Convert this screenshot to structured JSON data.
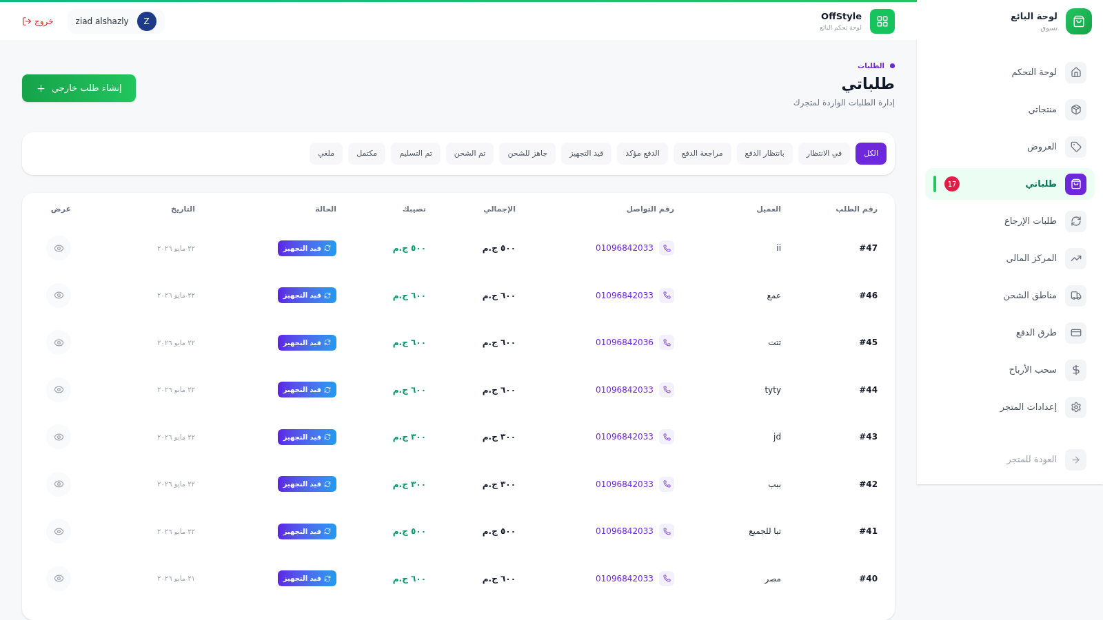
{
  "sidebar": {
    "title": "لوحة البائع",
    "subtitle": "تسوق",
    "items": [
      {
        "label": "لوحة التحكم",
        "selected": false
      },
      {
        "label": "منتجاتي",
        "selected": false
      },
      {
        "label": "العروض",
        "selected": false
      },
      {
        "label": "طلباتي",
        "selected": true,
        "badge": "17"
      },
      {
        "label": "طلبات الإرجاع",
        "selected": false
      },
      {
        "label": "المركز المالي",
        "selected": false
      },
      {
        "label": "مناطق الشحن",
        "selected": false
      },
      {
        "label": "طرق الدفع",
        "selected": false
      },
      {
        "label": "سحب الأرباح",
        "selected": false
      },
      {
        "label": "إعدادات المتجر",
        "selected": false
      }
    ],
    "back_link": "العودة للمتجر"
  },
  "header": {
    "brand": "OffStyle",
    "brand_subtitle": "لوحة تحكم البائع",
    "user_name": "ziad alshazly",
    "avatar_letter": "Z",
    "logout": "خروج"
  },
  "page": {
    "breadcrumb": "الطلبات",
    "title": "طلباتي",
    "subtitle": "إدارة الطلبات الواردة لمتجرك",
    "create_button": "إنشاء طلب خارجي"
  },
  "filters": [
    {
      "label": "الكل",
      "selected": true
    },
    {
      "label": "في الانتظار",
      "selected": false
    },
    {
      "label": "بانتظار الدفع",
      "selected": false
    },
    {
      "label": "مراجعة الدفع",
      "selected": false
    },
    {
      "label": "الدفع مؤكد",
      "selected": false
    },
    {
      "label": "قيد التجهيز",
      "selected": false
    },
    {
      "label": "جاهز للشحن",
      "selected": false
    },
    {
      "label": "تم الشحن",
      "selected": false
    },
    {
      "label": "تم التسليم",
      "selected": false
    },
    {
      "label": "مكتمل",
      "selected": false
    },
    {
      "label": "ملغي",
      "selected": false
    }
  ],
  "table": {
    "columns": [
      "رقم الطلب",
      "العميل",
      "رقم التواصل",
      "الإجمالي",
      "نصيبك",
      "الحالة",
      "التاريخ",
      "عرض"
    ],
    "rows": [
      {
        "order": "#47",
        "customer": "ii",
        "phone": "01096842033",
        "total": "٥٠٠ ج.م",
        "share": "٥٠٠ ج.م",
        "status": "قيد التجهيز",
        "date": "٢٢ مايو ٢٠٢٦"
      },
      {
        "order": "#46",
        "customer": "عمع",
        "phone": "01096842033",
        "total": "٦٠٠ ج.م",
        "share": "٦٠٠ ج.م",
        "status": "قيد التجهيز",
        "date": "٢٢ مايو ٢٠٢٦"
      },
      {
        "order": "#45",
        "customer": "تتت",
        "phone": "01096842036",
        "total": "٦٠٠ ج.م",
        "share": "٦٠٠ ج.م",
        "status": "قيد التجهيز",
        "date": "٢٢ مايو ٢٠٢٦"
      },
      {
        "order": "#44",
        "customer": "tyty",
        "phone": "01096842033",
        "total": "٦٠٠ ج.م",
        "share": "٦٠٠ ج.م",
        "status": "قيد التجهيز",
        "date": "٢٢ مايو ٢٠٢٦"
      },
      {
        "order": "#43",
        "customer": "jd",
        "phone": "01096842033",
        "total": "٣٠٠ ج.م",
        "share": "٣٠٠ ج.م",
        "status": "قيد التجهيز",
        "date": "٢٢ مايو ٢٠٢٦"
      },
      {
        "order": "#42",
        "customer": "ببب",
        "phone": "01096842033",
        "total": "٣٠٠ ج.م",
        "share": "٣٠٠ ج.م",
        "status": "قيد التجهيز",
        "date": "٢٢ مايو ٢٠٢٦"
      },
      {
        "order": "#41",
        "customer": "تبا للجميع",
        "phone": "01096842033",
        "total": "٥٠٠ ج.م",
        "share": "٥٠٠ ج.م",
        "status": "قيد التجهيز",
        "date": "٢٢ مايو ٢٠٢٦"
      },
      {
        "order": "#40",
        "customer": "مصر",
        "phone": "01096842033",
        "total": "٦٠٠ ج.م",
        "share": "٦٠٠ ج.م",
        "status": "قيد التجهيز",
        "date": "٢١ مايو ٢٠٢٦"
      }
    ]
  }
}
